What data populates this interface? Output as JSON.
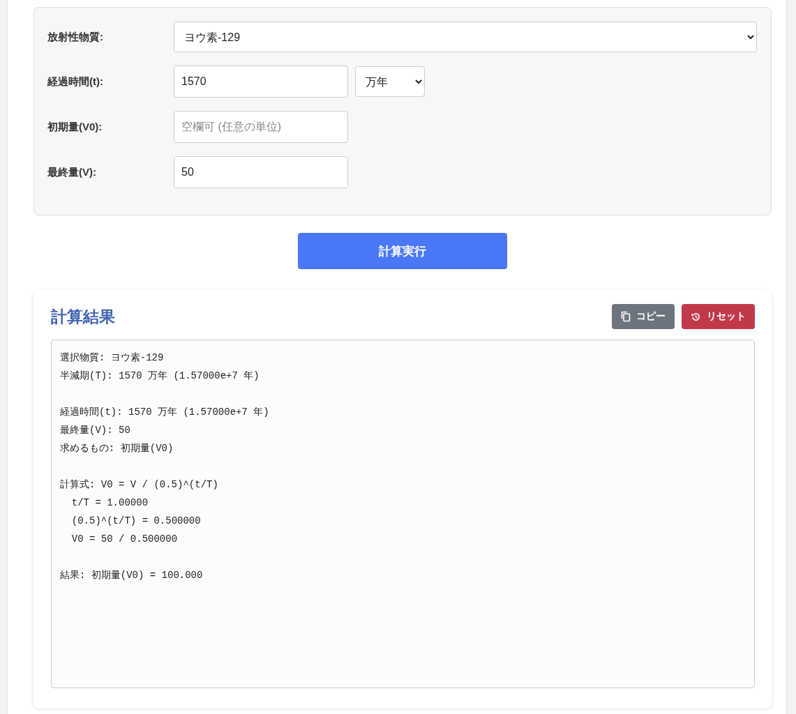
{
  "form": {
    "fields": [
      {
        "kind": "select",
        "label": "放射性物質:",
        "value": "ヨウ素-129"
      },
      {
        "kind": "number_unit",
        "label": "経過時間(t):",
        "value": "1570",
        "unit": "万年"
      },
      {
        "kind": "input",
        "label": "初期量(V0):",
        "placeholder": "空欄可 (任意の単位)"
      },
      {
        "kind": "input",
        "label": "最終量(V):",
        "value": "50"
      }
    ]
  },
  "calculate_button": "計算実行",
  "result": {
    "title": "計算結果",
    "buttons": [
      {
        "kind": "copy",
        "label": "コピー"
      },
      {
        "kind": "reset",
        "label": "リセット"
      }
    ],
    "text_blocks": [
      [
        "選択物質: ヨウ素-129",
        "半減期(T): 1570 万年 (1.57000e+7 年)"
      ],
      [
        "経過時間(t): 1570 万年 (1.57000e+7 年)",
        "最終量(V): 50",
        "求めるもの: 初期量(V0)"
      ],
      [
        "計算式: V0 = V / (0.5)^(t/T)",
        "  t/T = 1.00000",
        "  (0.5)^(t/T) = 0.500000",
        "  V0 = 50 / 0.500000"
      ],
      [
        "結果: 初期量(V0) = 100.000"
      ]
    ]
  }
}
